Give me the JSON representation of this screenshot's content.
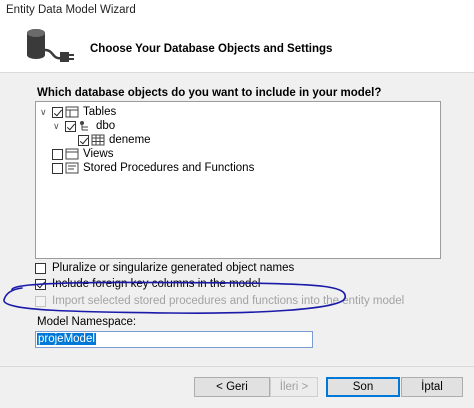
{
  "window": {
    "title": "Entity Data Model Wizard"
  },
  "header": {
    "title": "Choose Your Database Objects and Settings"
  },
  "main": {
    "question": "Which database objects do you want to include in your model?",
    "tree": {
      "tables": "Tables",
      "schema": "dbo",
      "table": "deneme",
      "views": "Views",
      "procedures": "Stored Procedures and Functions"
    },
    "options": {
      "pluralize": "Pluralize or singularize generated object names",
      "foreign_keys": "Include foreign key columns in the model",
      "import_procs": "Import selected stored procedures and functions into the entity model"
    },
    "namespace_label": "Model Namespace:",
    "namespace_value": "projeModel"
  },
  "buttons": {
    "back": "< Geri",
    "next": "İleri >",
    "finish": "Son",
    "cancel": "İptal"
  },
  "colors": {
    "annotation": "#1a1aa8",
    "selection": "#0078d7"
  }
}
